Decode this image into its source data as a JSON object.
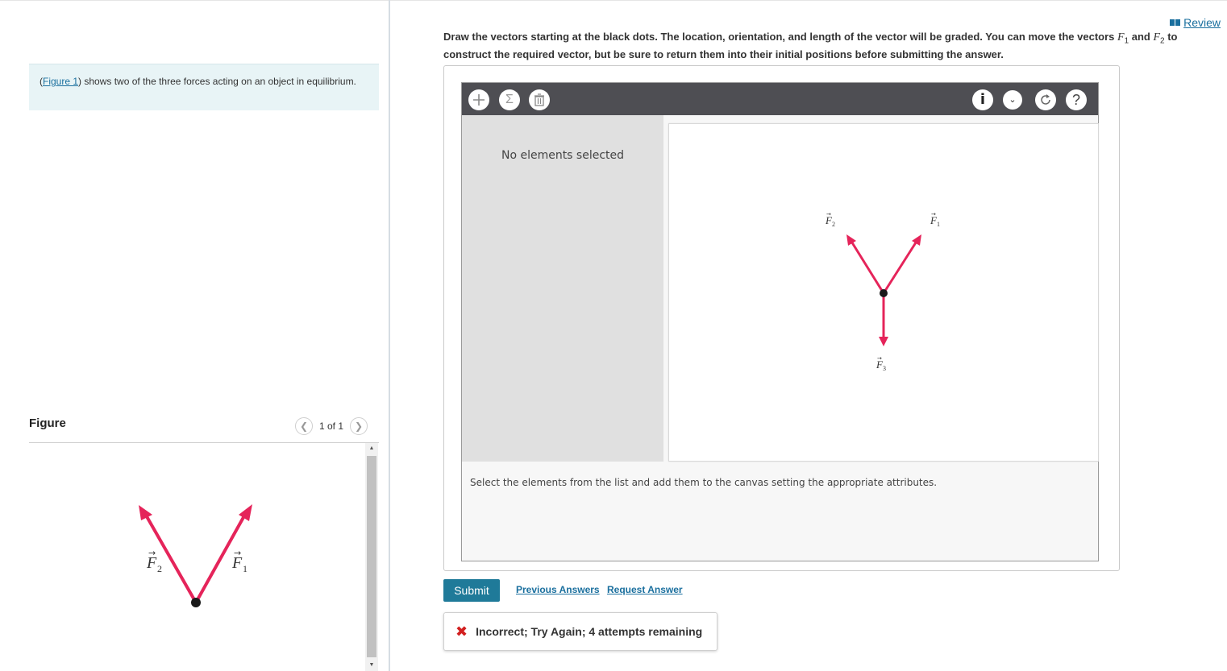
{
  "left": {
    "intro_link": "Figure 1",
    "intro_text": "shows two of the three forces acting on an object in equilibrium.",
    "figure_title": "Figure",
    "pager_text": "1 of 1",
    "figure_labels": {
      "f2": "F",
      "f2_sub": "2",
      "f1": "F",
      "f1_sub": "1"
    }
  },
  "right": {
    "review_label": "Review",
    "instructions_part1": "Draw the vectors starting at the black dots. The location, orientation, and length of the vector will be graded. You can move the vectors ",
    "f1": "F",
    "f1_sub": "1",
    "and_word": " and ",
    "f2": "F",
    "f2_sub": "2",
    "instructions_part2": " to construct the required vector, but be sure to return them into their initial positions before submitting the answer.",
    "tool": {
      "no_selection": "No elements selected",
      "hint": "Select the elements from the list and add them to the canvas setting the appropriate attributes.",
      "icons": [
        "plus-icon",
        "sigma-icon",
        "trash-icon",
        "info-icon",
        "chevron-down-icon",
        "reset-icon",
        "help-icon"
      ],
      "canvas_labels": {
        "f2": "F",
        "f2_sub": "2",
        "f1": "F",
        "f1_sub": "1",
        "f3": "F",
        "f3_sub": "3"
      }
    },
    "submit_label": "Submit",
    "previous_answers": "Previous Answers",
    "request_answer": "Request Answer",
    "feedback": "Incorrect; Try Again; 4 attempts remaining"
  },
  "colors": {
    "vector": "#e5245a",
    "accent": "#1f7a99",
    "link": "#1a6f9e",
    "toolbar": "#4e4e53"
  }
}
